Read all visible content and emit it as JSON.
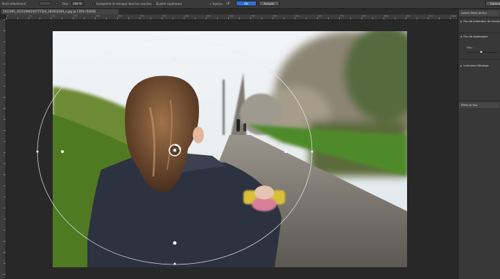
{
  "options_bar": {
    "selected_points": "Point sélectionné",
    "blur_label": "Flou :",
    "blur_value": "100 %",
    "save_mask_label": "Enregistrer le masque dans les couches",
    "high_quality_label": "Qualité supérieure",
    "preview_label": "Aperçu",
    "ok_label": "OK",
    "cancel_label": "Annuler",
    "right_button_label": "Galerie"
  },
  "document": {
    "tab_title": "1911995_10151980104771526_183910189_n.jpg @ 130% (RVB/8)"
  },
  "ruler": {
    "labels": [
      "0",
      "50",
      "100",
      "150",
      "200",
      "250",
      "300",
      "350",
      "400",
      "450",
      "500",
      "550",
      "600",
      "650",
      "700",
      "750",
      "800",
      "850",
      "900",
      "950",
      "1000"
    ]
  },
  "panel": {
    "tab_title": "Galerie Effets de flou",
    "items": [
      {
        "label": "Flou de profondeur de champ",
        "expanded": false
      },
      {
        "label": "Flou de diaphragme",
        "expanded": true
      },
      {
        "label": "Inclinaison-Décalage",
        "expanded": false
      }
    ],
    "blur_param_label": "Flou :",
    "effects_tab_title": "Effets de flou"
  },
  "colors": {
    "accent": "#2d6fd4",
    "panel_bg": "#383838",
    "canvas_bg": "#282828"
  }
}
